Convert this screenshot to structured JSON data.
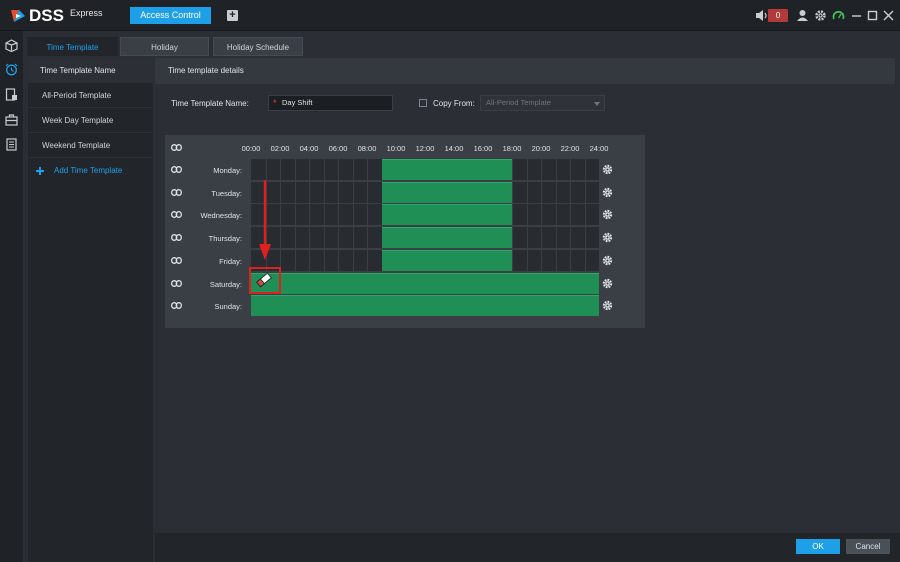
{
  "app": {
    "brand": "DSS",
    "edition": "Express",
    "active_module": "Access Control",
    "alarm_count": "0"
  },
  "module_tabs": [
    "Time Template",
    "Holiday",
    "Holiday Schedule"
  ],
  "left_list": {
    "header": "Time Template Name",
    "items": [
      "All-Period Template",
      "Week Day Template",
      "Weekend Template"
    ],
    "add_label": "Add Time Template"
  },
  "details": {
    "header": "Time template details",
    "name_label": "Time Template Name:",
    "name_value": "Day Shift",
    "copy_from_label": "Copy From:",
    "copy_from_value": "All-Period Template"
  },
  "schedule": {
    "hours": [
      "00:00",
      "02:00",
      "04:00",
      "06:00",
      "08:00",
      "10:00",
      "12:00",
      "14:00",
      "16:00",
      "18:00",
      "20:00",
      "22:00",
      "24:00"
    ],
    "days": [
      {
        "label": "Monday:",
        "periods": [
          [
            9,
            18
          ]
        ]
      },
      {
        "label": "Tuesday:",
        "periods": [
          [
            9,
            18
          ]
        ]
      },
      {
        "label": "Wednesday:",
        "periods": [
          [
            9,
            18
          ]
        ]
      },
      {
        "label": "Thursday:",
        "periods": [
          [
            9,
            18
          ]
        ]
      },
      {
        "label": "Friday:",
        "periods": [
          [
            9,
            18
          ]
        ]
      },
      {
        "label": "Saturday:",
        "periods": [
          [
            0,
            24
          ]
        ]
      },
      {
        "label": "Sunday:",
        "periods": [
          [
            0,
            24
          ]
        ]
      }
    ]
  },
  "footer": {
    "ok_label": "OK",
    "cancel_label": "Cancel"
  },
  "colors": {
    "accent": "#1ea0e9",
    "period_fill": "#1f8f55",
    "annotation": "#e01f1f"
  }
}
